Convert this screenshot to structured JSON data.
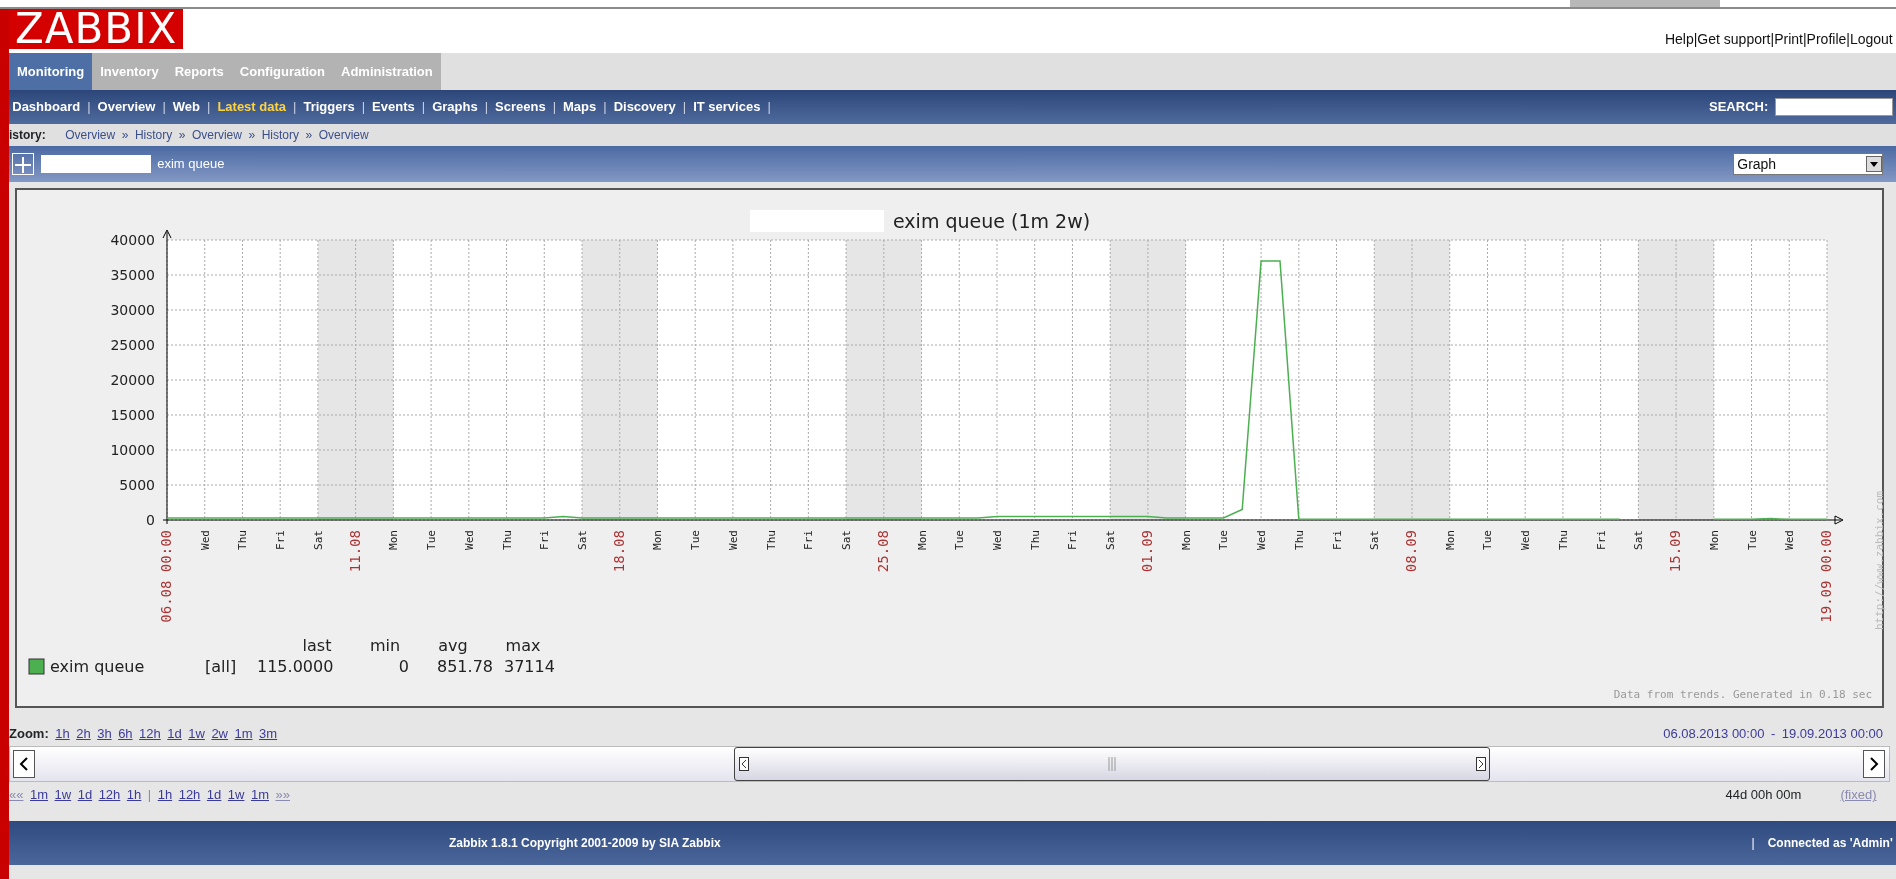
{
  "header": {
    "logo": "ZABBIX",
    "links": [
      "Help",
      "Get support",
      "Print",
      "Profile",
      "Logout"
    ],
    "separator": "|"
  },
  "main_tabs": [
    {
      "label": "Monitoring",
      "selected": true
    },
    {
      "label": "Inventory",
      "selected": false
    },
    {
      "label": "Reports",
      "selected": false
    },
    {
      "label": "Configuration",
      "selected": false
    },
    {
      "label": "Administration",
      "selected": false
    }
  ],
  "sub_tabs": [
    {
      "label": "Dashboard",
      "selected": false
    },
    {
      "label": "Overview",
      "selected": false
    },
    {
      "label": "Web",
      "selected": false
    },
    {
      "label": "Latest data",
      "selected": true
    },
    {
      "label": "Triggers",
      "selected": false
    },
    {
      "label": "Events",
      "selected": false
    },
    {
      "label": "Graphs",
      "selected": false
    },
    {
      "label": "Screens",
      "selected": false
    },
    {
      "label": "Maps",
      "selected": false
    },
    {
      "label": "Discovery",
      "selected": false
    },
    {
      "label": "IT services",
      "selected": false
    }
  ],
  "sub_separator": "|",
  "search": {
    "label": "SEARCH:"
  },
  "breadcrumb": {
    "label": "istory:",
    "items": [
      "Overview",
      "History",
      "Overview",
      "History",
      "Overview"
    ],
    "separator": "»"
  },
  "graph_header": {
    "title": "exim queue",
    "view_select": "Graph"
  },
  "chart": {
    "title": "exim queue  (1m 2w)",
    "chart_data": {
      "type": "line",
      "categories": [
        "06.08 00:00",
        null,
        "Wed",
        null,
        "Thu",
        null,
        "Fri",
        null,
        "Sat",
        null,
        "11.08",
        null,
        "Mon",
        null,
        "Tue",
        null,
        "Wed",
        null,
        "Thu",
        null,
        "Fri",
        null,
        "Sat",
        null,
        "18.08",
        null,
        "Mon",
        null,
        "Tue",
        null,
        "Wed",
        null,
        "Thu",
        null,
        "Fri",
        null,
        "Sat",
        null,
        "25.08",
        null,
        "Mon",
        null,
        "Tue",
        null,
        "Wed",
        null,
        "Thu",
        null,
        "Fri",
        null,
        "Sat",
        null,
        "01.09",
        null,
        "Mon",
        null,
        "Tue",
        null,
        "Wed",
        null,
        "Thu",
        null,
        "Fri",
        null,
        "Sat",
        null,
        "08.09",
        null,
        "Mon",
        null,
        "Tue",
        null,
        "Wed",
        null,
        "Thu",
        null,
        "Fri",
        null,
        "Sat",
        null,
        "15.09",
        null,
        "Mon",
        null,
        "Tue",
        null,
        "Wed",
        null,
        "19.09 00:00"
      ],
      "series": [
        {
          "name": "exim queue",
          "color": "#4caf50",
          "values": [
            300,
            300,
            300,
            300,
            300,
            300,
            300,
            300,
            300,
            300,
            300,
            300,
            300,
            300,
            300,
            300,
            300,
            300,
            300,
            300,
            300,
            500,
            300,
            300,
            300,
            300,
            300,
            300,
            300,
            300,
            300,
            300,
            300,
            300,
            300,
            300,
            300,
            300,
            300,
            300,
            300,
            300,
            300,
            300,
            500,
            500,
            500,
            500,
            500,
            500,
            500,
            500,
            500,
            300,
            300,
            300,
            300,
            1500,
            37000,
            37000,
            100,
            100,
            100,
            100,
            100,
            100,
            100,
            100,
            100,
            100,
            100,
            100,
            100,
            100,
            100,
            100,
            100,
            100,
            null,
            null,
            null,
            null,
            100,
            100,
            100,
            200,
            100,
            100,
            100
          ]
        }
      ],
      "grid": true,
      "ylim": [
        0,
        40000
      ],
      "yticks": [
        0,
        5000,
        10000,
        15000,
        20000,
        25000,
        30000,
        35000,
        40000
      ]
    },
    "legend": {
      "columns": [
        "last",
        "min",
        "avg",
        "max"
      ],
      "items": [
        {
          "function": "[all]",
          "values": [
            "115.0000",
            "0",
            "851.78",
            "37114"
          ]
        }
      ]
    },
    "note": "Data from trends. Generated in 0.18 sec",
    "url": "http://www.zabbix.com"
  },
  "zoom": {
    "label": "Zoom:",
    "options": [
      "1h",
      "2h",
      "3h",
      "6h",
      "12h",
      "1d",
      "1w",
      "2w",
      "1m",
      "3m"
    ]
  },
  "period": {
    "from": "06.08.2013 00:00",
    "separator": "-",
    "to": "19.09.2013 00:00"
  },
  "navigation": {
    "back": "««",
    "back_options": [
      "1m",
      "1w",
      "1d",
      "12h",
      "1h"
    ],
    "divider": "|",
    "forward_options": [
      "1h",
      "12h",
      "1d",
      "1w",
      "1m"
    ],
    "forward": "»»"
  },
  "duration": "44d 00h 00m",
  "fixed": "(fixed)",
  "footer": {
    "copyright": "Zabbix 1.8.1 Copyright 2001-2009 by SIA Zabbix",
    "separator": "|",
    "connected": "Connected as 'Admin'"
  }
}
